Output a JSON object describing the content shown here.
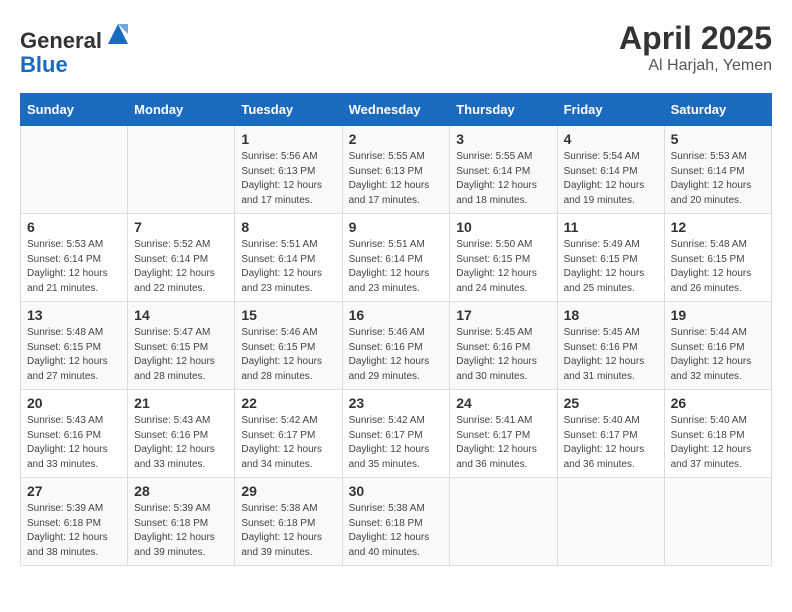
{
  "header": {
    "logo_line1": "General",
    "logo_line2": "Blue",
    "month_year": "April 2025",
    "location": "Al Harjah, Yemen"
  },
  "days_of_week": [
    "Sunday",
    "Monday",
    "Tuesday",
    "Wednesday",
    "Thursday",
    "Friday",
    "Saturday"
  ],
  "weeks": [
    [
      {
        "day": "",
        "info": ""
      },
      {
        "day": "",
        "info": ""
      },
      {
        "day": "1",
        "info": "Sunrise: 5:56 AM\nSunset: 6:13 PM\nDaylight: 12 hours and 17 minutes."
      },
      {
        "day": "2",
        "info": "Sunrise: 5:55 AM\nSunset: 6:13 PM\nDaylight: 12 hours and 17 minutes."
      },
      {
        "day": "3",
        "info": "Sunrise: 5:55 AM\nSunset: 6:14 PM\nDaylight: 12 hours and 18 minutes."
      },
      {
        "day": "4",
        "info": "Sunrise: 5:54 AM\nSunset: 6:14 PM\nDaylight: 12 hours and 19 minutes."
      },
      {
        "day": "5",
        "info": "Sunrise: 5:53 AM\nSunset: 6:14 PM\nDaylight: 12 hours and 20 minutes."
      }
    ],
    [
      {
        "day": "6",
        "info": "Sunrise: 5:53 AM\nSunset: 6:14 PM\nDaylight: 12 hours and 21 minutes."
      },
      {
        "day": "7",
        "info": "Sunrise: 5:52 AM\nSunset: 6:14 PM\nDaylight: 12 hours and 22 minutes."
      },
      {
        "day": "8",
        "info": "Sunrise: 5:51 AM\nSunset: 6:14 PM\nDaylight: 12 hours and 23 minutes."
      },
      {
        "day": "9",
        "info": "Sunrise: 5:51 AM\nSunset: 6:14 PM\nDaylight: 12 hours and 23 minutes."
      },
      {
        "day": "10",
        "info": "Sunrise: 5:50 AM\nSunset: 6:15 PM\nDaylight: 12 hours and 24 minutes."
      },
      {
        "day": "11",
        "info": "Sunrise: 5:49 AM\nSunset: 6:15 PM\nDaylight: 12 hours and 25 minutes."
      },
      {
        "day": "12",
        "info": "Sunrise: 5:48 AM\nSunset: 6:15 PM\nDaylight: 12 hours and 26 minutes."
      }
    ],
    [
      {
        "day": "13",
        "info": "Sunrise: 5:48 AM\nSunset: 6:15 PM\nDaylight: 12 hours and 27 minutes."
      },
      {
        "day": "14",
        "info": "Sunrise: 5:47 AM\nSunset: 6:15 PM\nDaylight: 12 hours and 28 minutes."
      },
      {
        "day": "15",
        "info": "Sunrise: 5:46 AM\nSunset: 6:15 PM\nDaylight: 12 hours and 28 minutes."
      },
      {
        "day": "16",
        "info": "Sunrise: 5:46 AM\nSunset: 6:16 PM\nDaylight: 12 hours and 29 minutes."
      },
      {
        "day": "17",
        "info": "Sunrise: 5:45 AM\nSunset: 6:16 PM\nDaylight: 12 hours and 30 minutes."
      },
      {
        "day": "18",
        "info": "Sunrise: 5:45 AM\nSunset: 6:16 PM\nDaylight: 12 hours and 31 minutes."
      },
      {
        "day": "19",
        "info": "Sunrise: 5:44 AM\nSunset: 6:16 PM\nDaylight: 12 hours and 32 minutes."
      }
    ],
    [
      {
        "day": "20",
        "info": "Sunrise: 5:43 AM\nSunset: 6:16 PM\nDaylight: 12 hours and 33 minutes."
      },
      {
        "day": "21",
        "info": "Sunrise: 5:43 AM\nSunset: 6:16 PM\nDaylight: 12 hours and 33 minutes."
      },
      {
        "day": "22",
        "info": "Sunrise: 5:42 AM\nSunset: 6:17 PM\nDaylight: 12 hours and 34 minutes."
      },
      {
        "day": "23",
        "info": "Sunrise: 5:42 AM\nSunset: 6:17 PM\nDaylight: 12 hours and 35 minutes."
      },
      {
        "day": "24",
        "info": "Sunrise: 5:41 AM\nSunset: 6:17 PM\nDaylight: 12 hours and 36 minutes."
      },
      {
        "day": "25",
        "info": "Sunrise: 5:40 AM\nSunset: 6:17 PM\nDaylight: 12 hours and 36 minutes."
      },
      {
        "day": "26",
        "info": "Sunrise: 5:40 AM\nSunset: 6:18 PM\nDaylight: 12 hours and 37 minutes."
      }
    ],
    [
      {
        "day": "27",
        "info": "Sunrise: 5:39 AM\nSunset: 6:18 PM\nDaylight: 12 hours and 38 minutes."
      },
      {
        "day": "28",
        "info": "Sunrise: 5:39 AM\nSunset: 6:18 PM\nDaylight: 12 hours and 39 minutes."
      },
      {
        "day": "29",
        "info": "Sunrise: 5:38 AM\nSunset: 6:18 PM\nDaylight: 12 hours and 39 minutes."
      },
      {
        "day": "30",
        "info": "Sunrise: 5:38 AM\nSunset: 6:18 PM\nDaylight: 12 hours and 40 minutes."
      },
      {
        "day": "",
        "info": ""
      },
      {
        "day": "",
        "info": ""
      },
      {
        "day": "",
        "info": ""
      }
    ]
  ]
}
